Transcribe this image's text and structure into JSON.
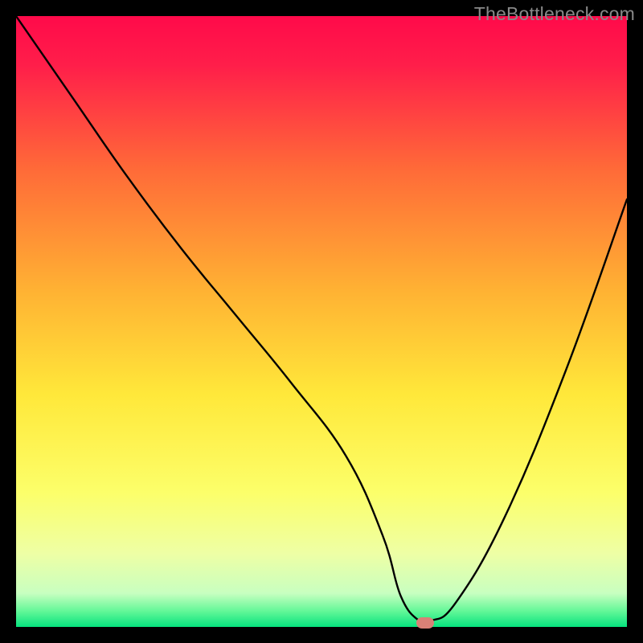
{
  "watermark": "TheBottleneck.com",
  "chart_data": {
    "type": "line",
    "title": "",
    "xlabel": "",
    "ylabel": "",
    "xlim": [
      0,
      100
    ],
    "ylim": [
      0,
      100
    ],
    "note": "Axes are percentage-like with no tick labels shown. Values are estimated from the plotted curve; lower y = better (green), higher y = worse (red).",
    "series": [
      {
        "name": "bottleneck-curve",
        "x": [
          0,
          9,
          18,
          27,
          36,
          45,
          54,
          60,
          63,
          66,
          68,
          72,
          80,
          90,
          100
        ],
        "y": [
          100,
          87,
          74,
          62,
          51,
          40,
          28,
          15,
          5,
          1,
          1,
          4,
          18,
          42,
          70
        ]
      }
    ],
    "marker": {
      "x": 67,
      "y": 0.7,
      "name": "optimal-point"
    },
    "background_gradient": {
      "stops": [
        {
          "offset": 0,
          "color": "#ff0a4a"
        },
        {
          "offset": 0.08,
          "color": "#ff1e4a"
        },
        {
          "offset": 0.25,
          "color": "#ff6a38"
        },
        {
          "offset": 0.45,
          "color": "#ffb233"
        },
        {
          "offset": 0.62,
          "color": "#ffe83a"
        },
        {
          "offset": 0.78,
          "color": "#fcff6a"
        },
        {
          "offset": 0.88,
          "color": "#eeffa5"
        },
        {
          "offset": 0.945,
          "color": "#c8ffc0"
        },
        {
          "offset": 0.975,
          "color": "#60f797"
        },
        {
          "offset": 1.0,
          "color": "#06e27e"
        }
      ]
    }
  }
}
